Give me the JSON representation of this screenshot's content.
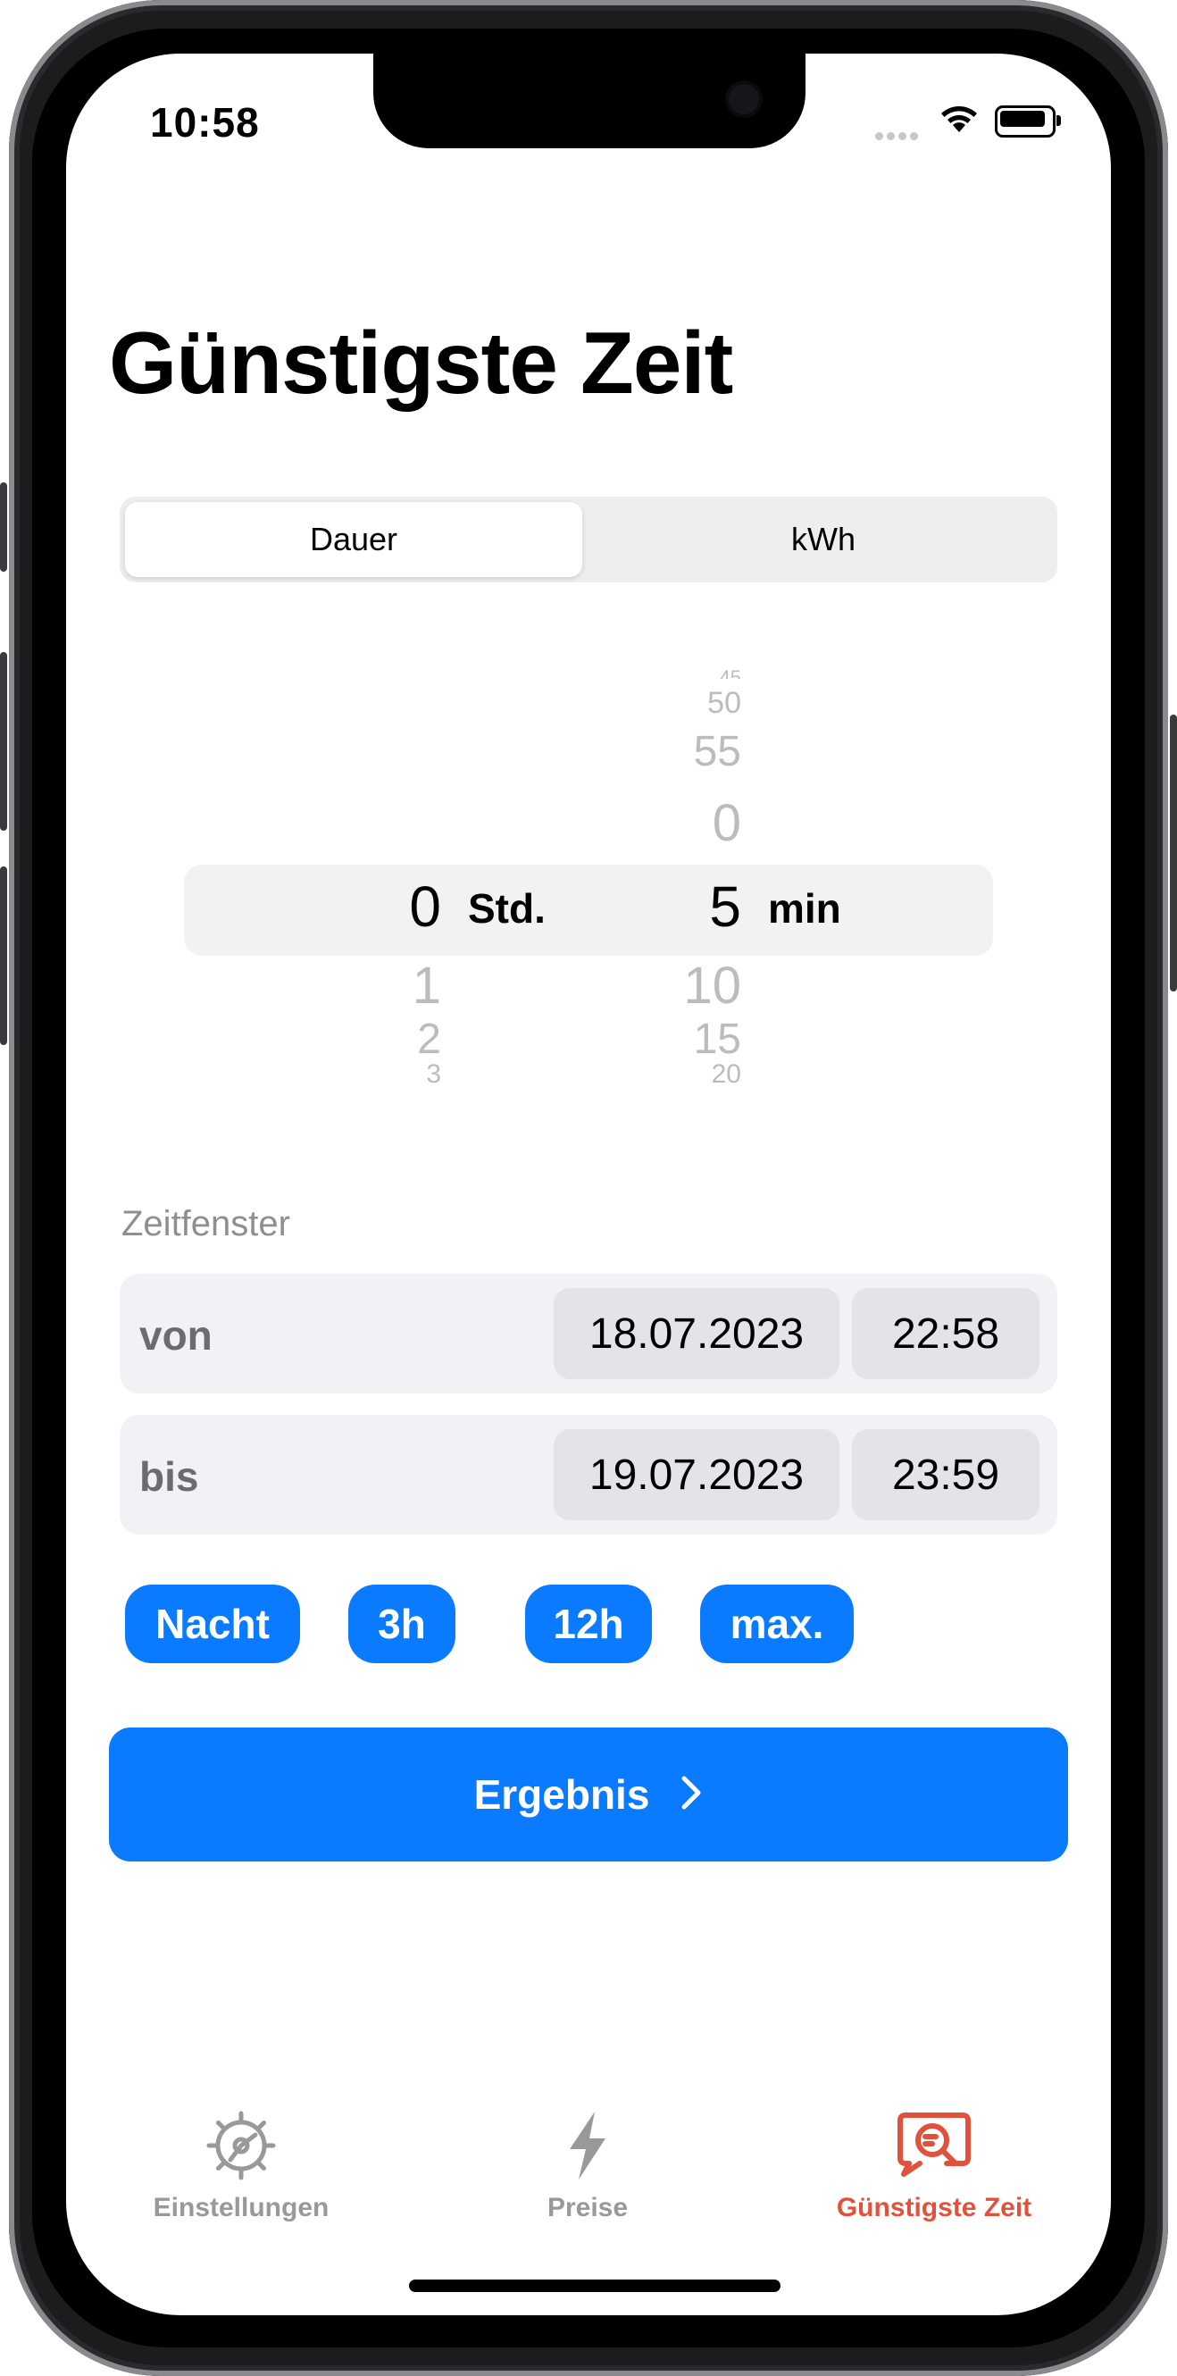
{
  "status_bar": {
    "time": "10:58"
  },
  "header": {
    "title": "Günstigste Zeit"
  },
  "segment": {
    "items": [
      "Dauer",
      "kWh"
    ],
    "selected": "Dauer"
  },
  "picker": {
    "hours": {
      "above": [
        "",
        "",
        ""
      ],
      "selected": "0",
      "below": [
        "1",
        "2",
        "3"
      ],
      "unit": "Std."
    },
    "minutes": {
      "above": [
        "45",
        "50",
        "55",
        "0"
      ],
      "selected": "5",
      "below": [
        "10",
        "15",
        "20"
      ],
      "unit": "min"
    }
  },
  "time_window": {
    "label": "Zeitfenster",
    "from": {
      "label": "von",
      "date": "18.07.2023",
      "time": "22:58"
    },
    "to": {
      "label": "bis",
      "date": "19.07.2023",
      "time": "23:59"
    }
  },
  "quick_buttons": [
    "Nacht",
    "3h",
    "12h",
    "max."
  ],
  "primary_button": {
    "label": "Ergebnis"
  },
  "tab_bar": {
    "items": [
      {
        "label": "Einstellungen",
        "icon": "gear-icon"
      },
      {
        "label": "Preise",
        "icon": "bolt-icon"
      },
      {
        "label": "Günstigste Zeit",
        "icon": "search-bubble-icon"
      }
    ],
    "active": "Günstigste Zeit",
    "active_color": "#e2513b",
    "inactive_color": "#999999"
  },
  "colors": {
    "accent": "#0a7aff"
  }
}
